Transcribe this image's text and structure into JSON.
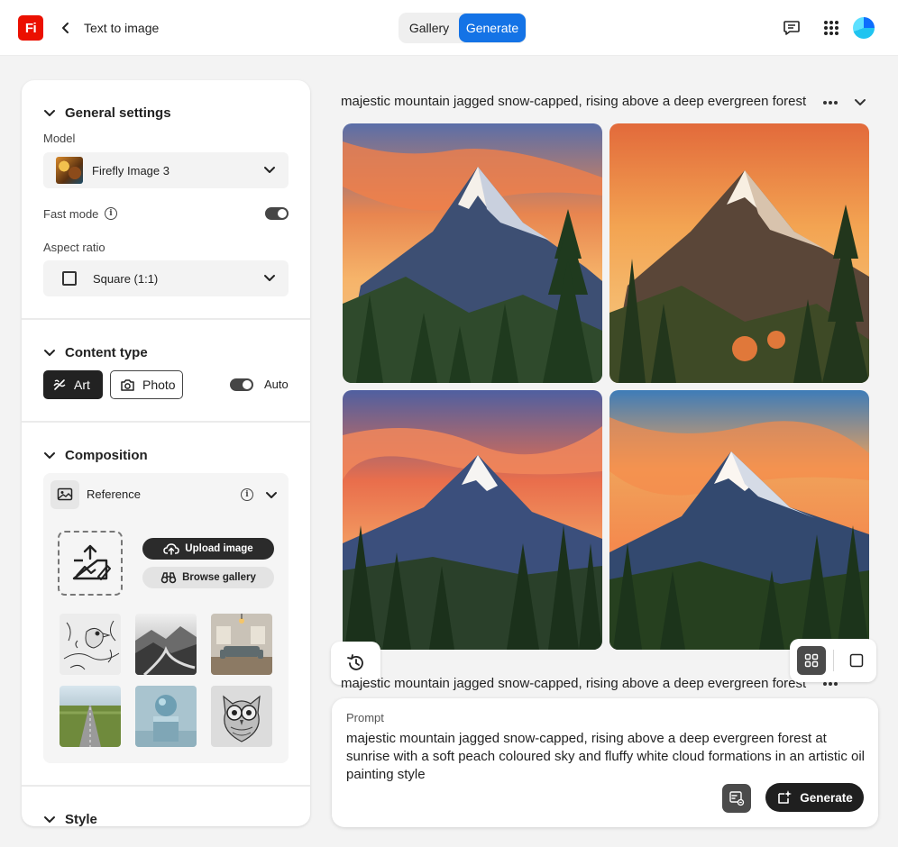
{
  "header": {
    "logo_text": "Fi",
    "title": "Text to image",
    "tabs": [
      "Gallery",
      "Generate"
    ],
    "active_tab": "Generate",
    "icons": [
      "back-icon",
      "feedback-icon",
      "apps-grid-icon",
      "avatar"
    ]
  },
  "colors": {
    "accent": "#1473e6",
    "brand": "#eb1000",
    "dark_button": "#1f1f1f"
  },
  "general_settings": {
    "title": "General settings",
    "model_label": "Model",
    "model_value": "Firefly Image 3",
    "fast_mode_label": "Fast mode",
    "fast_mode_on": true,
    "aspect_label": "Aspect ratio",
    "aspect_value": "Square (1:1)"
  },
  "content_type": {
    "title": "Content type",
    "art": "Art",
    "photo": "Photo",
    "selected": "Art",
    "auto_label": "Auto",
    "auto_on": true
  },
  "composition": {
    "title": "Composition",
    "reference_label": "Reference",
    "upload_label": "Upload image",
    "browse_label": "Browse gallery",
    "thumbnails": [
      "bird-sketch",
      "misty-mountains",
      "living-room",
      "road-field",
      "sphere-pedestal",
      "owl-sketch"
    ]
  },
  "style": {
    "title": "Style"
  },
  "results": {
    "prompt_truncated": "majestic mountain jagged snow-capped, rising above a deep evergreen forest ...",
    "image_count": 4,
    "view_mode": "grid"
  },
  "prompt_box": {
    "label": "Prompt",
    "text": "majestic mountain jagged snow-capped, rising above a deep evergreen forest at sunrise with a soft peach coloured sky and fluffy white cloud formations in an artistic oil painting style",
    "generate_label": "Generate"
  }
}
